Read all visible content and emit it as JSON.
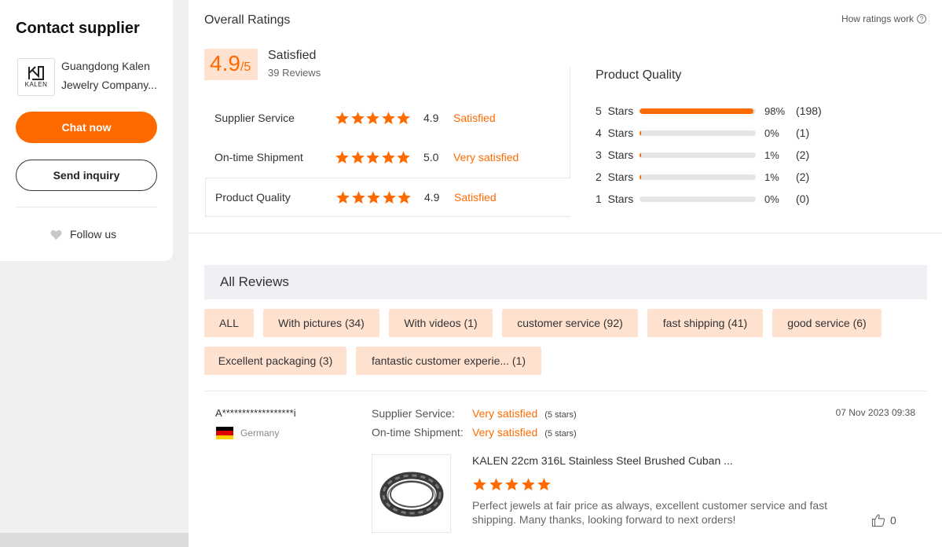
{
  "supplier_card": {
    "title": "Contact supplier",
    "logo_text": "KALEN",
    "company_line1": "Guangdong Kalen",
    "company_line2": "Jewelry Company...",
    "chat_label": "Chat now",
    "inquiry_label": "Send inquiry",
    "follow_label": "Follow us"
  },
  "overall": {
    "title": "Overall Ratings",
    "how_label": "How ratings work",
    "score": "4.9",
    "out_of": "/5",
    "satisfaction": "Satisfied",
    "reviews": "39 Reviews",
    "rows": [
      {
        "label": "Supplier Service",
        "stars": 5,
        "value": "4.9",
        "word": "Satisfied"
      },
      {
        "label": "On-time Shipment",
        "stars": 5,
        "value": "5.0",
        "word": "Very satisfied"
      },
      {
        "label": "Product Quality",
        "stars": 5,
        "value": "4.9",
        "word": "Satisfied"
      }
    ]
  },
  "product_quality": {
    "title": "Product Quality",
    "rows": [
      {
        "stars": "5",
        "label": "Stars",
        "fraction": 0.98,
        "pct": "98%",
        "count": "(198)"
      },
      {
        "stars": "4",
        "label": "Stars",
        "fraction": 0.005,
        "pct": "0%",
        "count": "(1)"
      },
      {
        "stars": "3",
        "label": "Stars",
        "fraction": 0.01,
        "pct": "1%",
        "count": "(2)"
      },
      {
        "stars": "2",
        "label": "Stars",
        "fraction": 0.01,
        "pct": "1%",
        "count": "(2)"
      },
      {
        "stars": "1",
        "label": "Stars",
        "fraction": 0.0,
        "pct": "0%",
        "count": "(0)"
      }
    ]
  },
  "all_reviews": {
    "title": "All Reviews",
    "filters": [
      "ALL",
      "With pictures (34)",
      "With videos (1)",
      "customer service (92)",
      "fast shipping (41)",
      "good service (6)",
      "Excellent packaging (3)",
      "fantastic customer experie...  (1)"
    ]
  },
  "review": {
    "reviewer": "A******************i",
    "country": "Germany",
    "supplier_service_label": "Supplier Service:",
    "supplier_service_value": "Very satisfied",
    "supplier_service_stars": "(5 stars)",
    "shipment_label": "On-time Shipment:",
    "shipment_value": "Very satisfied",
    "shipment_stars": "(5 stars)",
    "date": "07 Nov 2023 09:38",
    "product_title": "KALEN 22cm 316L Stainless Steel Brushed Cuban ...",
    "rating": 5,
    "text": "Perfect jewels at fair price as always, excellent customer service and fast shipping. Many thanks, looking forward to next orders!",
    "likes": "0"
  },
  "colors": {
    "accent": "#ff6a00",
    "chip_bg": "#ffe1d0",
    "header_bg": "#eef0f3"
  }
}
